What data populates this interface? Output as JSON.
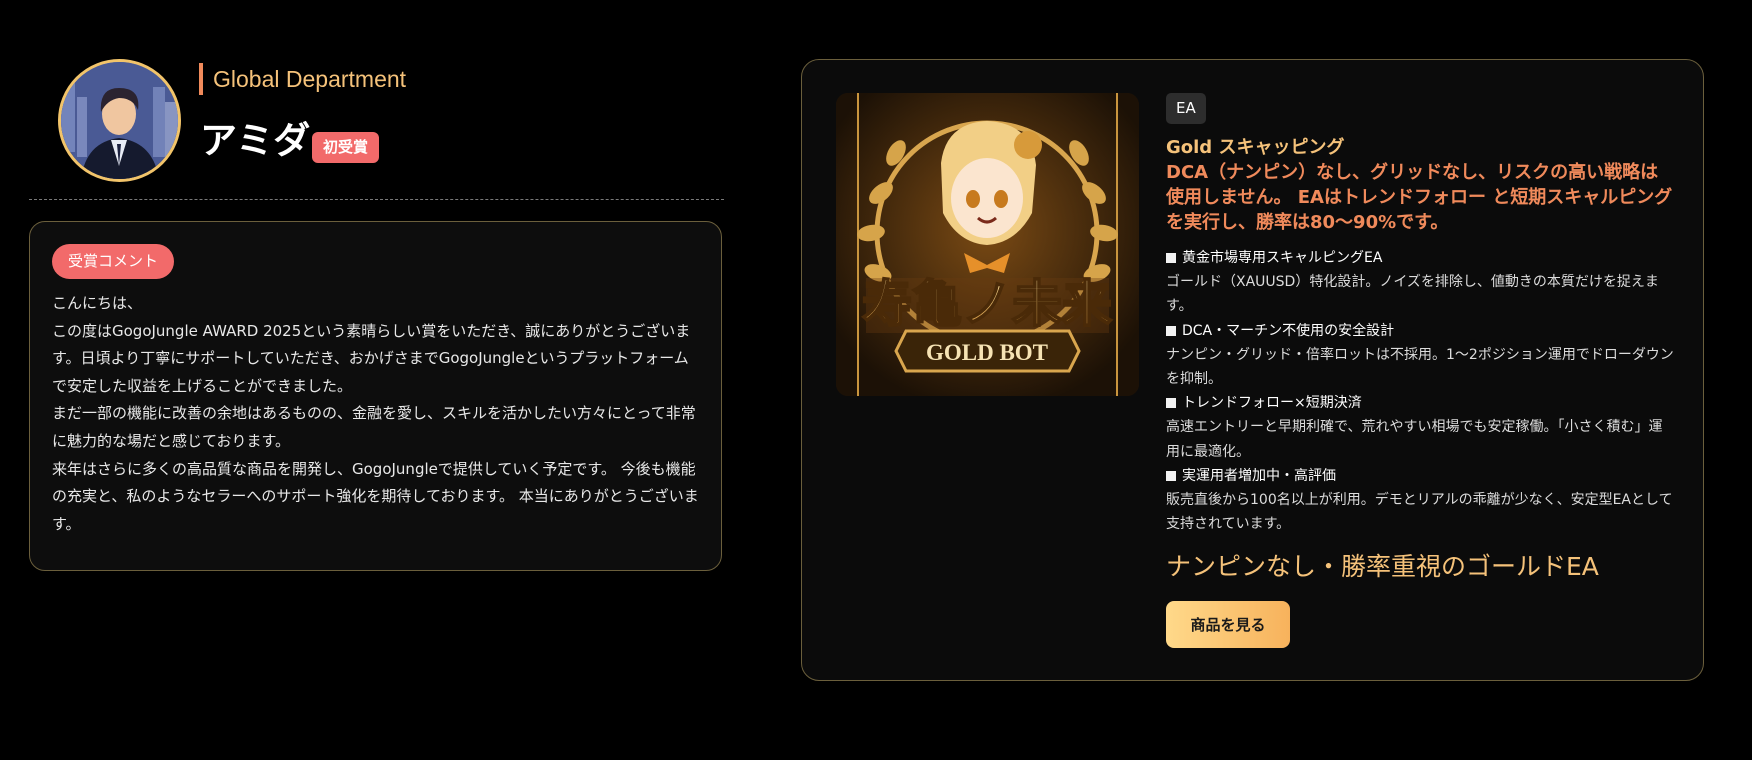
{
  "profile": {
    "department": "Global Department",
    "name": "アミダ",
    "badge": "初受賞"
  },
  "comment": {
    "badge": "受賞コメント",
    "paragraphs": [
      "こんにちは、",
      "この度はGogoJungle AWARD 2025という素晴らしい賞をいただき、誠にありがとうございます。日頃より丁寧にサポートしていただき、おかげさまでGogoJungleというプラットフォームで安定した収益を上げることができました。",
      "まだ一部の機能に改善の余地はあるものの、金融を愛し、スキルを活かしたい方々にとって非常に魅力的な場だと感じております。",
      "来年はさらに多くの高品質な商品を開発し、GogoJungleで提供していく予定です。 今後も機能の充実と、私のようなセラーへのサポート強化を期待しております。 本当にありがとうございます。"
    ]
  },
  "product": {
    "tag": "EA",
    "title": "Gold スキャッピング",
    "subtitle": "DCA（ナンピン）なし、グリッドなし、リスクの高い戦略は使用しません。 EAはトレンドフォロー と短期スキャルピングを実行し、勝率は80〜90%です。",
    "image_banner_text": "GOLD BOT",
    "image_logo_text": "寿亀ノ未来",
    "features": [
      {
        "heading": "黄金市場専用スキャルピングEA",
        "desc": "ゴールド（XAUUSD）特化設計。ノイズを排除し、値動きの本質だけを捉えます。"
      },
      {
        "heading": "DCA・マーチン不使用の安全設計",
        "desc": "ナンピン・グリッド・倍率ロットは不採用。1〜2ポジション運用でドローダウンを抑制。"
      },
      {
        "heading": "トレンドフォロー×短期決済",
        "desc": "高速エントリーと早期利確で、荒れやすい相場でも安定稼働。「小さく積む」運用に最適化。"
      },
      {
        "heading": "実運用者増加中・高評価",
        "desc": "販売直後から100名以上が利用。デモとリアルの乖離が少なく、安定型EAとして支持されています。"
      }
    ],
    "catchphrase": "ナンピンなし・勝率重視のゴールドEA",
    "button_label": "商品を見る"
  },
  "colors": {
    "background": "#000000",
    "gold": "#f5c27a",
    "accent_orange": "#f08a5b",
    "badge_red": "#f26a6a",
    "card_border": "#6b5f3c"
  }
}
